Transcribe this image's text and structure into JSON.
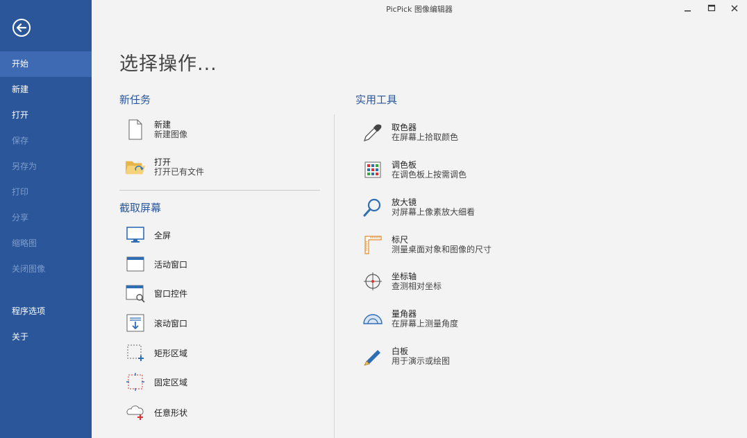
{
  "window": {
    "title": "PicPick 图像编辑器"
  },
  "sidebar": {
    "items": [
      {
        "label": "开始"
      },
      {
        "label": "新建"
      },
      {
        "label": "打开"
      },
      {
        "label": "保存"
      },
      {
        "label": "另存为"
      },
      {
        "label": "打印"
      },
      {
        "label": "分享"
      },
      {
        "label": "缩略图"
      },
      {
        "label": "关闭图像"
      },
      {
        "label": "程序选项"
      },
      {
        "label": "关于"
      }
    ]
  },
  "main": {
    "title": "选择操作...",
    "new_task": {
      "heading": "新任务",
      "items": [
        {
          "title": "新建",
          "desc": "新建图像"
        },
        {
          "title": "打开",
          "desc": "打开已有文件"
        }
      ]
    },
    "capture": {
      "heading": "截取屏幕",
      "items": [
        {
          "label": "全屏"
        },
        {
          "label": "活动窗口"
        },
        {
          "label": "窗口控件"
        },
        {
          "label": "滚动窗口"
        },
        {
          "label": "矩形区域"
        },
        {
          "label": "固定区域"
        },
        {
          "label": "任意形状"
        }
      ]
    },
    "tools": {
      "heading": "实用工具",
      "items": [
        {
          "title": "取色器",
          "desc": "在屏幕上拾取颜色"
        },
        {
          "title": "调色板",
          "desc": "在调色板上按需调色"
        },
        {
          "title": "放大镜",
          "desc": "对屏幕上像素放大细看"
        },
        {
          "title": "标尺",
          "desc": "测量桌面对象和图像的尺寸"
        },
        {
          "title": "坐标轴",
          "desc": "查测相对坐标"
        },
        {
          "title": "量角器",
          "desc": "在屏幕上测量角度"
        },
        {
          "title": "白板",
          "desc": "用于演示或绘图"
        }
      ]
    }
  },
  "colors": {
    "sidebar": "#2b579a",
    "sidebar_active": "#3d6ab3",
    "accent": "#2b579a",
    "background": "#f3f3f3"
  }
}
